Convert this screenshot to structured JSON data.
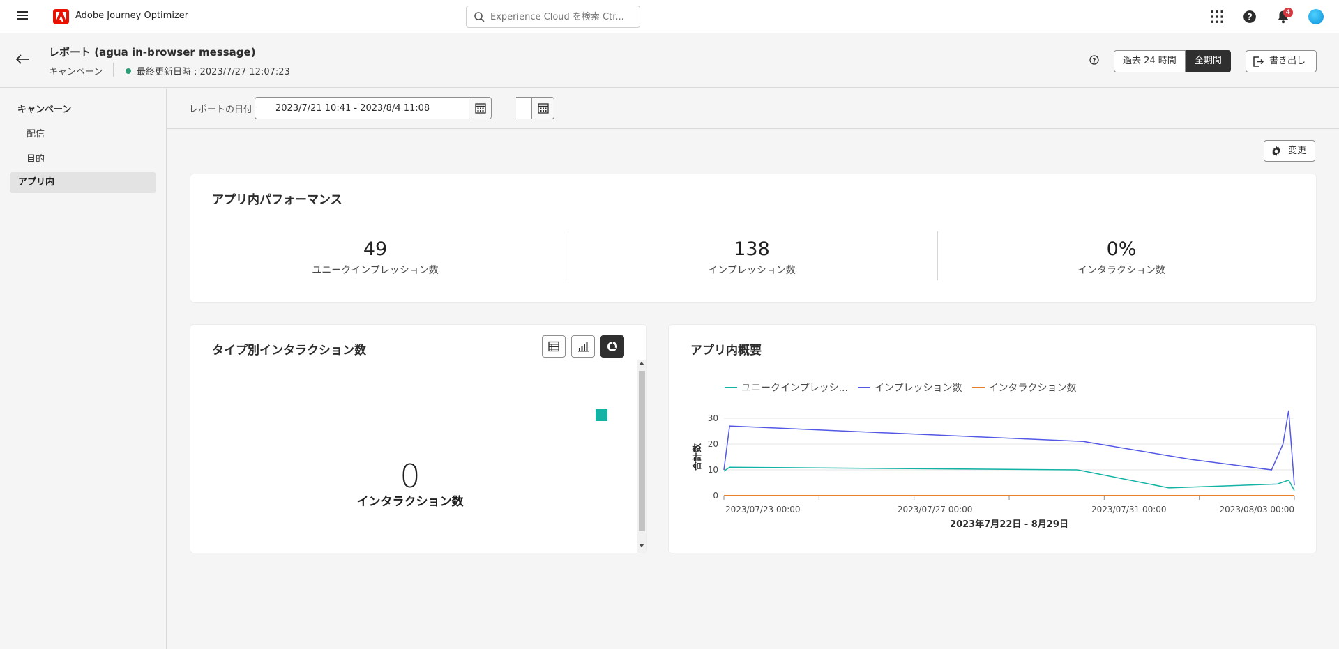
{
  "nav": {
    "app_name": "Adobe Journey Optimizer",
    "search_placeholder": "Experience Cloud を検索 Ctr...",
    "notification_count": "4"
  },
  "header": {
    "title": "レポート (agua in-browser message)",
    "subtitle": "キャンペーン",
    "last_updated": "最終更新日時 : 2023/7/27 12:07:23",
    "range_24h": "過去 24 時間",
    "range_all": "全期間",
    "export_label": "書き出し"
  },
  "sidebar": {
    "heading": "キャンペーン",
    "items": [
      {
        "label": "配信"
      },
      {
        "label": "目的"
      },
      {
        "label": "アプリ内"
      }
    ]
  },
  "filter": {
    "label": "レポートの日付",
    "date_range": "2023/7/21 10:41   -   2023/8/4 11:08"
  },
  "content": {
    "change_label": "変更"
  },
  "performance": {
    "title": "アプリ内パフォーマンス",
    "kpis": [
      {
        "value": "49",
        "label": "ユニークインプレッション数"
      },
      {
        "value": "138",
        "label": "インプレッション数"
      },
      {
        "value": "0%",
        "label": "インタラクション数"
      }
    ]
  },
  "interactions": {
    "title": "タイプ別インタラクション数",
    "total_value": "0",
    "total_label": "インタラクション数"
  },
  "overview": {
    "title": "アプリ内概要"
  },
  "colors": {
    "accent_teal": "#12b2a5",
    "impressions": "#5258e4",
    "unique": "#12b2a5",
    "interactions": "#e6802d"
  },
  "chart_data": {
    "type": "line",
    "ylabel": "合計数",
    "xlabel": "2023年7月22日 - 8月29日",
    "ylim": [
      0,
      30
    ],
    "yticks": [
      "0",
      "10",
      "20",
      "30"
    ],
    "xticks": [
      "2023/07/23 00:00",
      "2023/07/27 00:00",
      "2023/07/31 00:00",
      "2023/08/03 00:00"
    ],
    "series": [
      {
        "name": "ユニークインプレッシ...",
        "color": "#12b2a5",
        "x": [
          0,
          0.01,
          0.62,
          0.78,
          0.97,
          0.99,
          1.0
        ],
        "values": [
          9.5,
          11,
          10,
          3,
          4.5,
          6,
          2
        ]
      },
      {
        "name": "インプレッション数",
        "color": "#5258e4",
        "x": [
          0,
          0.01,
          0.63,
          0.82,
          0.96,
          0.98,
          0.99,
          1.0
        ],
        "values": [
          10,
          27,
          21,
          14,
          10,
          20,
          33,
          4
        ]
      },
      {
        "name": "インタラクション数",
        "color": "#e6802d",
        "x": [
          0,
          1.0
        ],
        "values": [
          0,
          0
        ]
      }
    ]
  }
}
